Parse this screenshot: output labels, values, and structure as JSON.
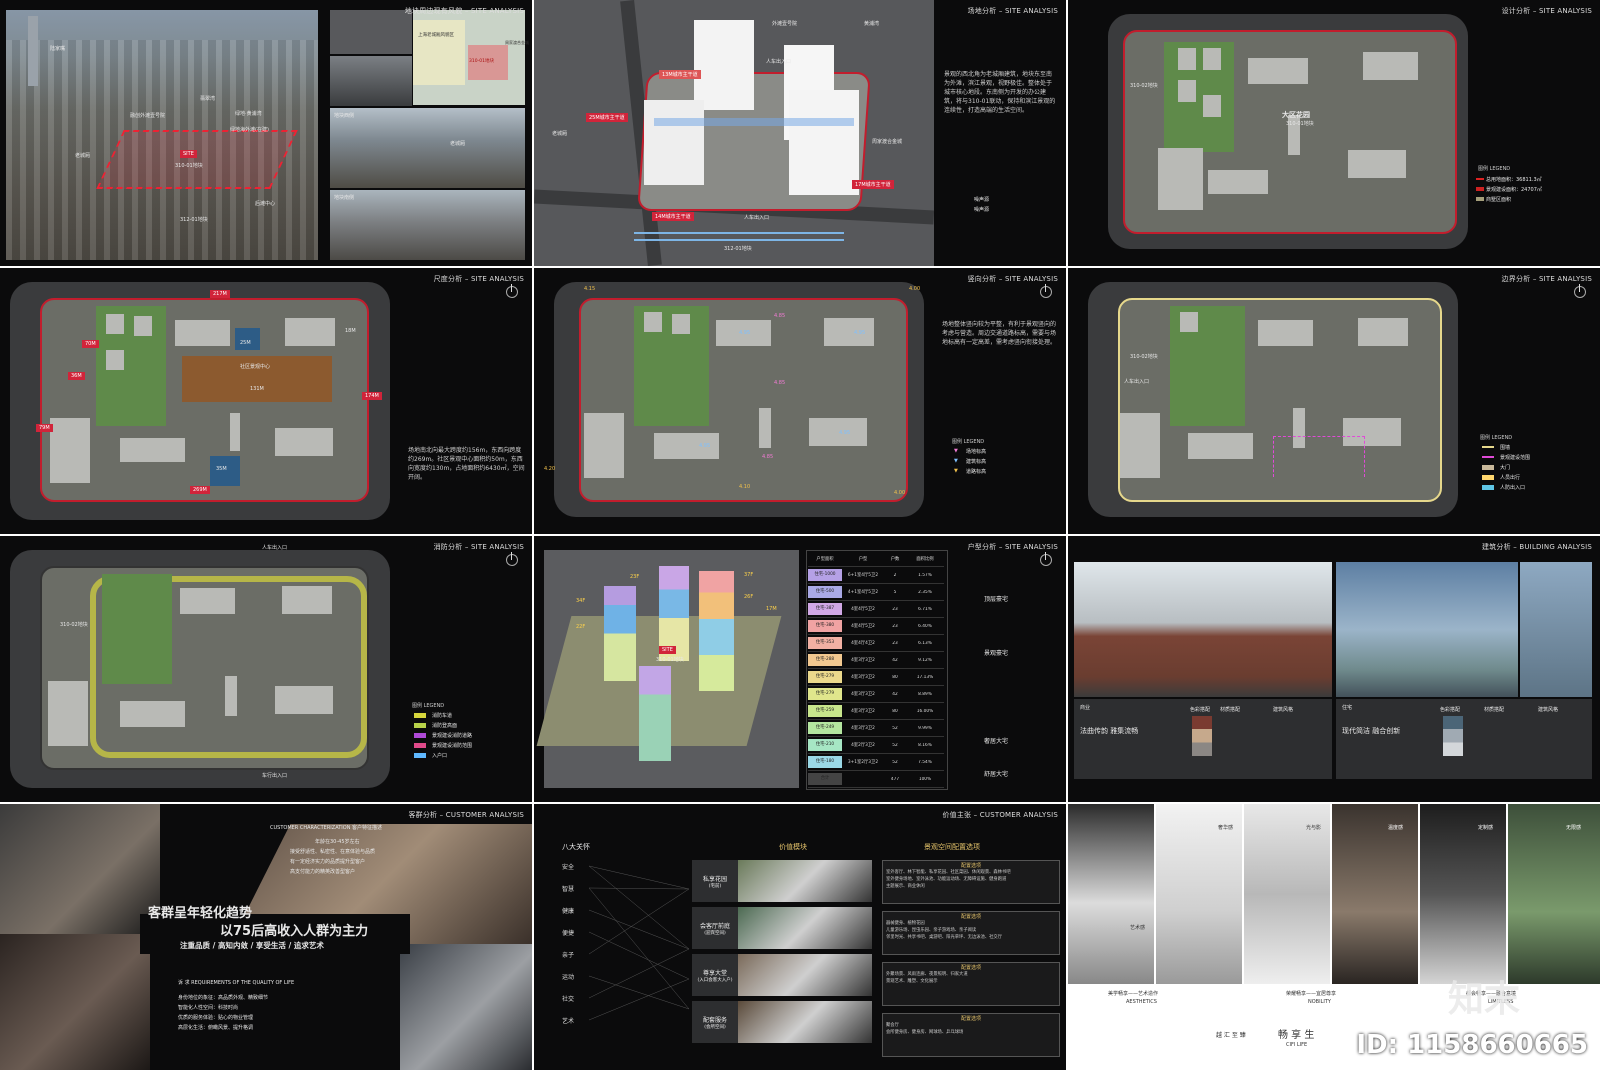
{
  "panels": [
    {
      "title": "地块周边现有风貌 – SITE ANALYSIS",
      "labels": [
        "陆家嘴",
        "翡翠湾",
        "绿地·黄浦湾",
        "绿地海外滩(在建)",
        "融创外滩壹号院",
        "老城厢",
        "SITE",
        "310-01地块",
        "312-01地块",
        "后滩中心",
        "上海老城厢风貌区",
        "310-01地块",
        "周家渡合金城",
        "地块西侧",
        "地块东侧",
        "地块南侧",
        "老城厢"
      ]
    },
    {
      "title": "场地分析 – SITE ANALYSIS",
      "labels": [
        "13M城市主干道",
        "25M城市主干道",
        "14M城市主干道",
        "17M城市主干道",
        "地块东侧",
        "老城厢",
        "外滩壹号院",
        "黄浦湾",
        "周家渡合金城",
        "312-01地块",
        "人车出入口",
        "车行出入口",
        "人车出入口",
        "车行出入口"
      ],
      "text": "景观的西北角为老城厢建筑，地块东至南为外滩，滨江景观，视野极佳。整体处于城市核心地段。东南侧为开发的办公建筑，将与310-01联动，保持和滨江景观的连续性，打造高端的生活空间。",
      "legend": [
        "噪声源",
        "噪声源"
      ]
    },
    {
      "title": "设计分析 – SITE ANALYSIS",
      "labels": [
        "大区花园",
        "310-01地块",
        "310-02地块",
        "D1#",
        "D2#",
        "D3#",
        "D4#",
        "D5#",
        "D6#",
        "D7#",
        "1F",
        "2F",
        "3F",
        "4F",
        "5F",
        "6F",
        "7F",
        "8F"
      ],
      "legend_title": "图例 LEGEND",
      "legend": [
        "总用地面积：36811.3㎡",
        "景观建设面积：24707㎡",
        "商墅区面积"
      ]
    },
    {
      "title": "尺度分析 – SITE ANALYSIS",
      "labels": [
        "217M",
        "269M",
        "79M",
        "36M",
        "70M",
        "174M",
        "131M",
        "25M",
        "35M",
        "18M",
        "28M",
        "57M",
        "21M",
        "46M",
        "65M",
        "32M",
        "25M",
        "14M",
        "8M"
      ],
      "text": "场地南北向最大跨度约156m，东西向跨度约269m。社区景观中心面积约50m，东西向宽度约130m，占地面积约6430㎡，空间开阔。",
      "center": "社区景观中心"
    },
    {
      "title": "竖向分析 – SITE ANALYSIS",
      "labels": [
        "4.15",
        "4.95",
        "4.95",
        "4.95",
        "4.85",
        "4.85",
        "4.85",
        "4.95",
        "4.95",
        "4.20",
        "4.10",
        "4.00",
        "4.00"
      ],
      "text": "场地整体竖向较为平整，有利于景观竖向的考虑与营造。周边交通道路标高，需要与场地标高有一定高差，需考虑竖向衔接处理。",
      "legend_title": "图例 LEGEND",
      "legend": [
        "场地标高",
        "建筑标高",
        "道路标高"
      ]
    },
    {
      "title": "边界分析 – SITE ANALYSIS",
      "labels": [
        "310-02地块",
        "人车出入口"
      ],
      "legend_title": "图例 LEGEND",
      "legend": [
        "围墙",
        "景观建设范围",
        "大门",
        "人员出行",
        "人防出入口"
      ]
    },
    {
      "title": "消防分析 – SITE ANALYSIS",
      "labels": [
        "310-02地块",
        "人车出入口",
        "车行出入口"
      ],
      "legend_title": "图例 LEGEND",
      "legend": [
        "消防车道",
        "消防登高面",
        "景观建设消防道路",
        "景观建设消防范围",
        "入户口"
      ]
    },
    {
      "title": "户型分析 – SITE ANALYSIS",
      "labels": [
        "SITE",
        "310-01地块",
        "34F",
        "22F",
        "23F",
        "25F",
        "37F",
        "38F",
        "26F",
        "36F",
        "2F",
        "17M",
        "6M"
      ],
      "table": {
        "headers": [
          "户型面积",
          "户型",
          "户数",
          "面积比例"
        ],
        "rows": [
          [
            "住宅-1000",
            "6+1室4厅5卫2",
            "2",
            "1.57%"
          ],
          [
            "住宅-500",
            "4+1室4厅5卫2",
            "5",
            "2.35%"
          ],
          [
            "住宅-387",
            "4室4厅5卫2",
            "23",
            "6.71%"
          ],
          [
            "住宅-380",
            "4室4厅5卫2",
            "23",
            "6.40%"
          ],
          [
            "住宅-353",
            "4室4厅4卫2",
            "23",
            "6.13%"
          ],
          [
            "住宅-288",
            "4室3厅3卫2",
            "42",
            "9.12%"
          ],
          [
            "住宅-279",
            "4室3厅3卫2",
            "80",
            "17.13%"
          ],
          [
            "住宅-279",
            "4室3厅3卫2",
            "42",
            "8.89%"
          ],
          [
            "住宅-259",
            "4室3厅3卫2",
            "80",
            "16.00%"
          ],
          [
            "住宅-249",
            "4室3厅3卫2",
            "52",
            "9.99%"
          ],
          [
            "住宅-210",
            "4室2厅3卫2",
            "52",
            "8.16%"
          ],
          [
            "住宅-180",
            "3+1室2厅3卫2",
            "52",
            "7.54%"
          ],
          [
            "合计",
            "",
            "477",
            "100%"
          ]
        ],
        "groups": [
          "顶层豪宅",
          "景观豪宅",
          "奢居大宅",
          "舒居大宅"
        ]
      }
    },
    {
      "title": "建筑分析 – BUILDING ANALYSIS",
      "left": {
        "tag": "商业",
        "heading": "法曲传韵 雅集流畅",
        "sub": [
          "色彩搭配",
          "材质搭配",
          "建筑风格"
        ]
      },
      "right": {
        "tag": "住宅",
        "heading": "现代简洁 融合创新",
        "sub": [
          "色彩搭配",
          "材质搭配",
          "建筑风格"
        ]
      }
    },
    {
      "title": "客群分析 – CUSTOMER ANALYSIS",
      "sub": "CUSTOMER CHARACTERIZATION 客户特征描述",
      "desc": [
        "年龄在30-45岁左右",
        "接受舒适性、私密性、在意体验与品质",
        "有一定经济实力的品质提升型客户",
        "高支付能力的精英改善型客户"
      ],
      "headline1": "客群呈年轻化趋势",
      "headline2": "以75后高收入人群为主力",
      "headline3": "注重品质 / 高知内敛 / 享受生活 / 追求艺术",
      "req_title": "诉 求  REQUIREMENTS OF THE QUALITY OF LIFE",
      "req": [
        "身份地位的象征：高品质外观、精致细节",
        "智能化人性空间：科技时尚",
        "优质的服务体验：贴心的物业管理",
        "高层化生活：俯瞰风景、提升格调"
      ]
    },
    {
      "title": "价值主张 – CUSTOMER ANALYSIS",
      "col1": "八大关怀",
      "col2": "价值模块",
      "col3": "景观空间配置选项",
      "cares": [
        "安全",
        "智慧",
        "健康",
        "便捷",
        "亲子",
        "运动",
        "社交",
        "艺术"
      ],
      "modules": [
        {
          "name": "私享花园",
          "sub": "(宅前)"
        },
        {
          "name": "会客厅前庭",
          "sub": "(迎宾空间)"
        },
        {
          "name": "尊享大堂",
          "sub": "(入口会客大入户)"
        },
        {
          "name": "配套服务",
          "sub": "(会所空间)"
        }
      ],
      "opt_title": "配置选项",
      "options": [
        "室外客厅、林下智能、私享花园、社区菜园、休闲观景、森林书吧",
        "室外健身场地、室外泳池、功能运动场、无障碍设施、健身跑道",
        "主题展示、商业休闲",
        "器械健身、植物花园",
        "儿童游乐场、昆虫乐园、亲子游戏场、亲子阅读",
        "邻里时光、共享书吧、桌游吧、阳光草坪、无边泳池、社交厅",
        "外聚场景、风雨连廊、夜景照明、归家大道",
        "景观艺术、雕塑、文化展示",
        "聚会厅",
        "会所健身房、健身房、网球场、乒乓球场"
      ]
    },
    {
      "title": "",
      "captions": [
        "艺术感",
        "奢华感",
        "光与影",
        "温度感",
        "定制感",
        "无限感"
      ],
      "bottom": [
        "美学畅享——艺术造作",
        "AESTHETICS",
        "荣耀畅享——宜居尊享",
        "NOBILITY",
        "都会畅享——融合意境",
        "LIMITLESS"
      ],
      "footer_left": "越 汇 至 臻",
      "footer_mid": "畅 享 生",
      "footer_en": "CIFI LIFE",
      "id": "ID: 1158660665",
      "brand": "知末"
    }
  ]
}
